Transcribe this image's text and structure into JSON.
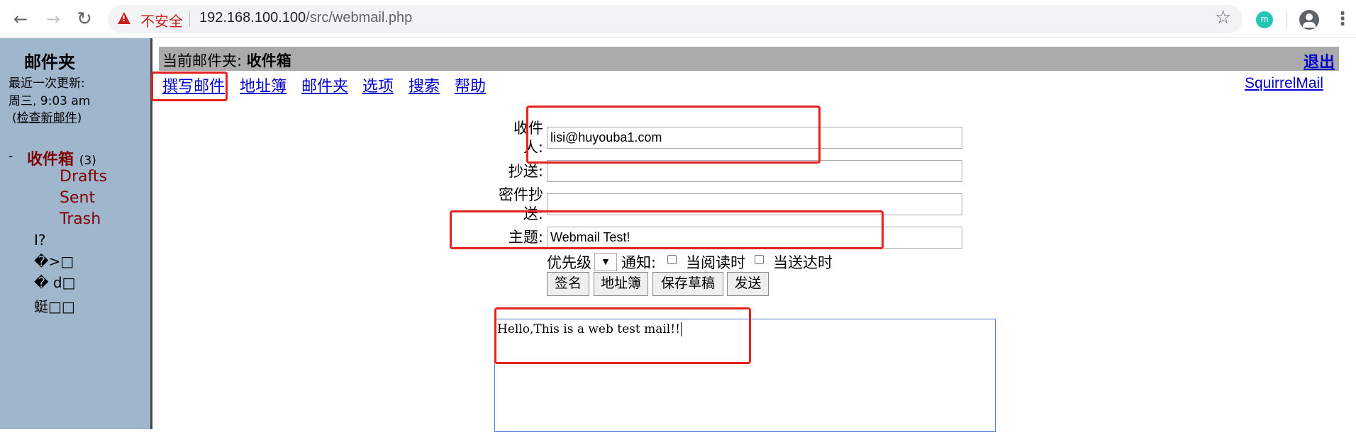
{
  "browser": {
    "security_label": "不安全",
    "url_host": "192.168.100.100",
    "url_path": "/src/webmail.php",
    "extension_letter": "m",
    "icons": [
      "back-icon",
      "forward-icon",
      "reload-icon",
      "warning-icon",
      "star-icon",
      "extension-icon",
      "account-icon",
      "menu-icon"
    ]
  },
  "sidebar": {
    "title": "邮件夹",
    "last_refresh_label": "最近一次更新:",
    "last_refresh_time": "周三, 9:03 am",
    "check_mail_open": "(",
    "check_mail": "检查新邮件",
    "check_mail_close": ")",
    "collapse_marker": "-",
    "inbox_label": "收件箱",
    "inbox_count": "(3)",
    "folders": [
      "Drafts",
      "Sent",
      "Trash"
    ],
    "garbled_folders": [
      "I?",
      "�>□",
      "� d□",
      "蜓□□"
    ],
    "folder_color": "#800000",
    "background_color": "#9fb6cd"
  },
  "header": {
    "current_folder_label": "当前邮件夹: ",
    "current_folder": "收件箱",
    "signout": "退出",
    "nav": [
      "撰写邮件",
      "地址簿",
      "邮件夹",
      "选项",
      "搜索",
      "帮助"
    ],
    "brand": "SquirrelMail",
    "link_color": "#0000cc",
    "bar_color": "#ababab"
  },
  "compose": {
    "to_label_line1": "收件",
    "to_label_line2": "人:",
    "to_value": "lisi@huyouba1.com",
    "cc_label": "抄送:",
    "cc_value": "",
    "bcc_label_line1": "密件抄",
    "bcc_label_line2": "送:",
    "bcc_value": "",
    "subject_label": "主题:",
    "subject_value": "Webmail Test!",
    "priority_label": "优先级",
    "priority_value": "",
    "notify_label": "通知:",
    "notify_read_label": "当阅读时",
    "notify_delivered_label": "当送达时",
    "buttons": [
      "签名",
      "地址簿",
      "保存草稿",
      "发送"
    ],
    "body_text": "Hello,This is a web test mail!!"
  },
  "annotation_color": "#e3231e"
}
